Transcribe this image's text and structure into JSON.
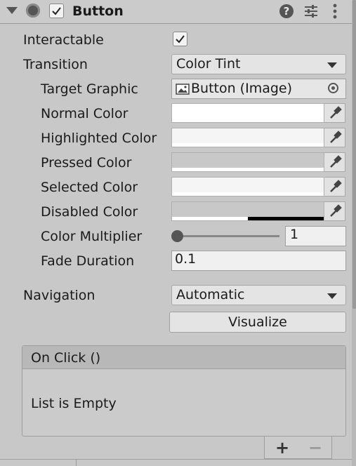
{
  "component": {
    "title": "Button",
    "enabled": true
  },
  "fields": {
    "interactable_label": "Interactable",
    "interactable_checked": true,
    "transition_label": "Transition",
    "transition_value": "Color Tint",
    "target_graphic_label": "Target Graphic",
    "target_graphic_value": "Button (Image)",
    "normal_color_label": "Normal Color",
    "highlighted_color_label": "Highlighted Color",
    "pressed_color_label": "Pressed Color",
    "selected_color_label": "Selected Color",
    "disabled_color_label": "Disabled Color",
    "color_multiplier_label": "Color Multiplier",
    "color_multiplier_value": "1",
    "color_multiplier_slider_fraction": 0.0,
    "fade_duration_label": "Fade Duration",
    "fade_duration_value": "0.1",
    "navigation_label": "Navigation",
    "navigation_value": "Automatic",
    "visualize_label": "Visualize"
  },
  "colors": {
    "normal": "#ffffff",
    "highlighted": "#f5f5f5",
    "pressed": "#c8c8c8",
    "selected": "#f5f5f5",
    "disabled": "#c8c8c8",
    "disabled_alpha_bar": "#000000",
    "accent_bg": "#c8c8c8"
  },
  "events": {
    "title": "On Click ()",
    "empty_text": "List is Empty",
    "add_symbol": "+",
    "remove_symbol": "−"
  },
  "icons": [
    "foldout-arrow-icon",
    "component-icon",
    "checkbox-icon",
    "help-icon",
    "presets-icon",
    "more-options-icon",
    "image-icon",
    "object-picker-icon",
    "eyedropper-icon",
    "dropdown-arrow-icon"
  ]
}
